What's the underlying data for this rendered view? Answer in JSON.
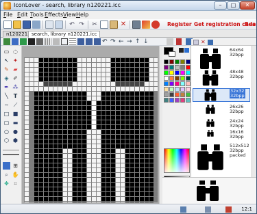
{
  "window": {
    "title": "IconLover - search, library n120221.icc"
  },
  "menu": [
    "File",
    "Edit",
    "Tools",
    "Effects",
    "View",
    "Help"
  ],
  "toolbar": {
    "register_label": "Register",
    "regcode_label": "Get registration code",
    "read_label": "Rea"
  },
  "tabs": [
    "n120221.icc",
    "search, library n120221.icc"
  ],
  "formats": [
    {
      "label": "64x64\n32bpp",
      "size": 32
    },
    {
      "label": "48x48\n32bpp",
      "size": 24
    },
    {
      "label": "32x32\n32bpp",
      "size": 18,
      "selected": true
    },
    {
      "label": "26x26\n32bpp",
      "size": 14
    },
    {
      "label": "24x24\n32bpp",
      "size": 12
    },
    {
      "label": "16x16\n32bpp",
      "size": 10
    },
    {
      "label": "512x512\n32bpp\npacked",
      "size": 40
    }
  ],
  "status": {
    "zoom": "12:1"
  },
  "colors": {
    "palette": [
      "#000000",
      "#800000",
      "#008000",
      "#808000",
      "#000080",
      "#800080",
      "#008080",
      "#c0c0c0",
      "#808080",
      "#ff0000",
      "#00ff00",
      "#ffff00",
      "#0000ff",
      "#ff00ff",
      "#00ffff",
      "#ffffff",
      "#ff8040",
      "#804000",
      "#80ff00",
      "#004040",
      "#0080ff",
      "#8000ff",
      "#ff0080",
      "#80ffff",
      "#ffc0c0",
      "#ffe0a0",
      "#c0ffc0",
      "#c0e0ff",
      "#e0c0ff",
      "#ffd0e0",
      "#a0a0a0",
      "#404040",
      "#ff6030",
      "#c08040",
      "#40c040",
      "#408080",
      "#4060ff",
      "#a040c0",
      "#e04080",
      "#60c0c0"
    ],
    "accent": "#3875d7"
  },
  "icons": [
    "new-icon",
    "open-icon",
    "save-icon",
    "cut-icon",
    "copy-icon",
    "paste-icon",
    "delete-icon",
    "undo-icon",
    "redo-icon",
    "grid-icon",
    "zoom-in-icon",
    "zoom-out-icon",
    "pencil-icon",
    "fill-icon",
    "eraser-icon",
    "brush-icon",
    "text-icon",
    "line-icon",
    "rect-icon",
    "ellipse-icon",
    "select-icon",
    "eyedropper-icon"
  ]
}
